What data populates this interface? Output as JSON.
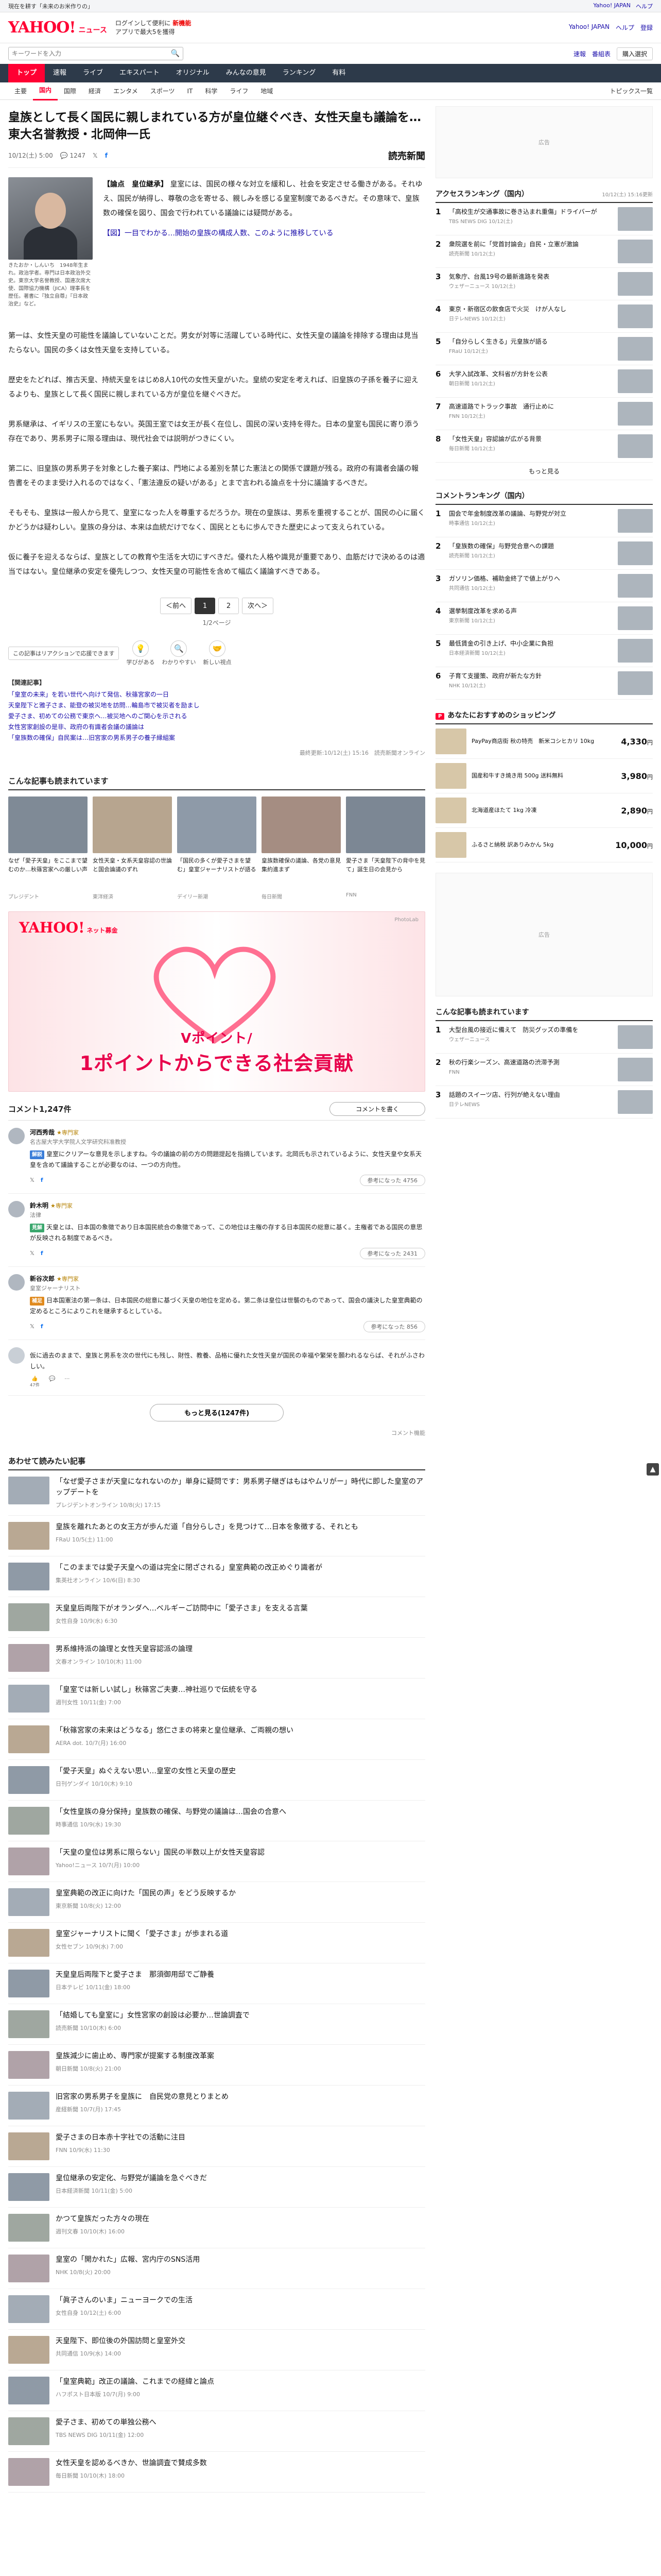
{
  "top_strip": {
    "left_text": "現在を耕す「未来のお米作りの」",
    "links": [
      "Yahoo! JAPAN",
      "ヘルプ"
    ]
  },
  "header": {
    "logo": "YAHOO!",
    "logo_sub": "ニュース",
    "logo_region": "JAPAN",
    "promo_line1": "ログインして便利に",
    "promo_line1_bold": "新機能",
    "promo_line2": "アプリで最大5を獲得",
    "links": [
      "Yahoo! JAPAN",
      "ヘルプ",
      "登録"
    ]
  },
  "search": {
    "placeholder": "キーワードを入力",
    "right_links": [
      "速報",
      "番組表"
    ],
    "right_button": "購入選択"
  },
  "nav": {
    "categories": [
      "トップ",
      "速報",
      "ライブ",
      "エキスパート",
      "オリジナル",
      "みんなの意見",
      "ランキング",
      "有料"
    ],
    "active_category": "トップ"
  },
  "subnav": {
    "items": [
      "主要",
      "国内",
      "国際",
      "経済",
      "エンタメ",
      "スポーツ",
      "IT",
      "科学",
      "ライフ",
      "地域"
    ],
    "active": "国内",
    "right": "トピックス一覧"
  },
  "article": {
    "title": "皇族として長く国民に親しまれている方が皇位継ぐべき、女性天皇も議論を…東大名誉教授・北岡伸一氏",
    "date": "10/12(土) 5:00",
    "comments_count": "1247",
    "source": "読売新聞",
    "section_tag": "【論点　皇位継承】",
    "photo_caption": "きたおか・しんいち　1948年生まれ。政治学者。専門は日本政治外交史。東京大学名誉教授、国連次席大使、国際協力機構（JICA）理事長を歴任。著書に『独立自尊』『日本政治史』など。",
    "lead_para": "皇室には、国民の様々な対立を緩和し、社会を安定させる働きがある。それゆえ、国民が納得し、尊敬の念を寄せる、親しみを感じる皇室制度であるべきだ。その意味で、皇族数の確保を図り、国会で行われている議論には疑問がある。",
    "lead_link": "【図】一目でわかる…開始の皇族の構成人数、このように推移している",
    "paragraphs": [
      "第一は、女性天皇の可能性を議論していないことだ。男女が対等に活躍している時代に、女性天皇の議論を排除する理由は見当たらない。国民の多くは女性天皇を支持している。",
      "歴史をたどれば、推古天皇、持統天皇をはじめ8人10代の女性天皇がいた。皇統の安定を考えれば、旧皇族の子孫を養子に迎えるよりも、皇族として長く国民に親しまれている方が皇位を継ぐべきだ。",
      "男系継承は、イギリスの王室にもない。英国王室では女王が長く在位し、国民の深い支持を得た。日本の皇室も国民に寄り添う存在であり、男系男子に限る理由は、現代社会では説明がつきにくい。",
      "第二に、旧皇族の男系男子を対象とした養子案は、門地による差別を禁じた憲法との関係で課題が残る。政府の有識者会議の報告書をそのまま受け入れるのではなく、「憲法違反の疑いがある」とまで言われる論点を十分に議論するべきだ。",
      "そもそも、皇族は一般人から見て、皇室になった人を尊重するだろうか。現在の皇族は、男系を重視することが、国民の心に届くかどうかは疑わしい。皇族の身分は、本来は血統だけでなく、国民とともに歩んできた歴史によって支えられている。",
      "仮に養子を迎えるならば、皇族としての教育や生活を大切にすべきだ。優れた人格や識見が重要であり、血筋だけで決めるのは適当ではない。皇位継承の安定を優先しつつ、女性天皇の可能性を含めて幅広く議論すべきである。"
    ],
    "pager": {
      "prev": "＜前へ",
      "pages": [
        "1",
        "2"
      ],
      "current": "1",
      "next": "次へ＞",
      "count": "1/2ページ"
    },
    "reaction_label": "この記事はリアクションで応援できます",
    "reactions": [
      {
        "icon": "💡",
        "label": "学びがある"
      },
      {
        "icon": "🔍",
        "label": "わかりやすい"
      },
      {
        "icon": "🤝",
        "label": "新しい視点"
      }
    ],
    "related_title": "【関連記事】",
    "related_links": [
      "「皇室の未来」を若い世代へ向けて発信、秋篠宮家の一日",
      "天皇陛下と雅子さま、能登の被災地を訪問…輪島市で被災者を励まし",
      "愛子さま、初めての公務で東京へ…被災地へのご関心を示される",
      "女性宮家創設の是非、政府の有識者会議の議論は",
      "「皇族数の確保」自民案は…旧宮家の男系男子の養子縁組案"
    ],
    "copyright": "最終更新:10/12(土) 15:16　読売新聞オンライン"
  },
  "picks": {
    "title": "こんな記事も読まれています",
    "items": [
      {
        "title": "なぜ「愛子天皇」をここまで望むのか…秋篠宮家への厳しい声",
        "meta": "プレジデント"
      },
      {
        "title": "女性天皇・女系天皇容認の世論と国会論議のずれ",
        "meta": "東洋経済"
      },
      {
        "title": "「国民の多くが愛子さまを望む」皇室ジャーナリストが語る",
        "meta": "デイリー新潮"
      },
      {
        "title": "皇族数確保の議論、各党の意見集約進まず",
        "meta": "毎日新聞"
      },
      {
        "title": "愛子さま「天皇陛下の背中を見て」誕生日の会見から",
        "meta": "FNN"
      }
    ]
  },
  "ad": {
    "logo": "YAHOO!",
    "logo_sub": "ネット募金",
    "corner": "PhotoLab",
    "copy_small": "Vポイント/",
    "copy_main": "1ポイントからできる社会貢献"
  },
  "comments": {
    "title": "コメント1,247件",
    "write_button": "コメントを書く",
    "items": [
      {
        "name": "河西秀哉",
        "badge": "★専門家",
        "role": "名古屋大学大学院人文学研究科准教授",
        "tag": "解説",
        "tag_color": "#3b7dd8",
        "text": "皇室にクリアーな意見を示しますね。今の議論の前の方の問題提起を指摘しています。北岡氏も示されているように、女性天皇や女系天皇を含めて議論することが必要なのは、一つの方向性。",
        "agree": "参考になった 4756"
      },
      {
        "name": "鈴木明",
        "badge": "★専門家",
        "role": "法律",
        "tag": "見解",
        "tag_color": "#3aa76d",
        "text": "天皇とは、日本国の象徴であり日本国民統合の象徴であって、この地位は主権の存する日本国民の総意に基く。主権者である国民の意思が反映される制度であるべき。",
        "agree": "参考になった 2431"
      },
      {
        "name": "新谷次郎",
        "badge": "★専門家",
        "role": "皇室ジャーナリスト",
        "tag": "補足",
        "tag_color": "#e08a1e",
        "text": "日本国憲法の第一条は、日本国民の総意に基づく天皇の地位を定める。第二条は皇位は世襲のものであって、国会の議決した皇室典範の定めるところによりこれを継承するとしている。",
        "agree": "参考になった 856"
      }
    ],
    "reader_comment": "仮に過去のままで、皇族と男系を次の世代にも残し、財性、教養、品格に優れた女性天皇が国民の幸福や繁栄を願われるならば、それがふさわしい。",
    "reader_likes": "47件",
    "more_button": "もっと見る(1247件)",
    "note": "コメント機能"
  },
  "also_read": {
    "title": "あわせて読みたい記事",
    "items": [
      {
        "title": "「なぜ愛子さまが天皇になれないのか」単身に疑問です：男系男子継ぎはもはやムリがー」時代に即した皇室のアップデートを",
        "meta": "プレジデントオンライン 10/8(火) 17:15"
      },
      {
        "title": "皇族を離れたあとの女王方が歩んだ道「自分らしさ」を見つけて…日本を象徴する、それとも",
        "meta": "FRaU 10/5(土) 11:00"
      },
      {
        "title": "「このままでは愛子天皇への道は完全に閉ざされる」皇室典範の改正めぐり識者が",
        "meta": "集英社オンライン 10/6(日) 8:30"
      },
      {
        "title": "天皇皇后両陛下がオランダへ…ベルギーご訪問中に「愛子さま」を支える言葉",
        "meta": "女性自身 10/9(水) 6:30"
      },
      {
        "title": "男系維持派の論理と女性天皇容認派の論理",
        "meta": "文春オンライン 10/10(木) 11:00"
      },
      {
        "title": "「皇室では新しい試し」秋篠宮ご夫妻…神社巡りで伝統を守る",
        "meta": "週刊女性 10/11(金) 7:00"
      },
      {
        "title": "「秋篠宮家の未来はどうなる」悠仁さまの将来と皇位継承、ご両親の想い",
        "meta": "AERA dot. 10/7(月) 16:00"
      },
      {
        "title": "「愛子天皇」ぬぐえない思い…皇室の女性と天皇の歴史",
        "meta": "日刊ゲンダイ 10/10(木) 9:10"
      },
      {
        "title": "「女性皇族の身分保持」皇族数の確保、与野党の議論は…国会の合意へ",
        "meta": "時事通信 10/9(水) 19:30"
      },
      {
        "title": "「天皇の皇位は男系に限らない」国民の半数以上が女性天皇容認",
        "meta": "Yahoo!ニュース 10/7(月) 10:00"
      },
      {
        "title": "皇室典範の改正に向けた「国民の声」をどう反映するか",
        "meta": "東京新聞 10/8(火) 12:00"
      },
      {
        "title": "皇室ジャーナリストに聞く「愛子さま」が歩まれる道",
        "meta": "女性セブン 10/9(水) 7:00"
      },
      {
        "title": "天皇皇后両陛下と愛子さま　那須御用邸でご静養",
        "meta": "日本テレビ 10/11(金) 18:00"
      },
      {
        "title": "「結婚しても皇室に」女性宮家の創設は必要か…世論調査で",
        "meta": "読売新聞 10/10(木) 6:00"
      },
      {
        "title": "皇族減少に歯止め、専門家が提案する制度改革案",
        "meta": "朝日新聞 10/8(火) 21:00"
      },
      {
        "title": "旧宮家の男系男子を皇族に　自民党の意見とりまとめ",
        "meta": "産経新聞 10/7(月) 17:45"
      },
      {
        "title": "愛子さまの日本赤十字社での活動に注目",
        "meta": "FNN 10/9(水) 11:30"
      },
      {
        "title": "皇位継承の安定化、与野党が議論を急ぐべきだ",
        "meta": "日本経済新聞 10/11(金) 5:00"
      },
      {
        "title": "かつて皇族だった方々の現在",
        "meta": "週刊文春 10/10(木) 16:00"
      },
      {
        "title": "皇室の「開かれた」広報、宮内庁のSNS活用",
        "meta": "NHK 10/8(火) 20:00"
      },
      {
        "title": "「眞子さんのいま」ニューヨークでの生活",
        "meta": "女性自身 10/12(土) 6:00"
      },
      {
        "title": "天皇陛下、即位後の外国訪問と皇室外交",
        "meta": "共同通信 10/9(水) 14:00"
      },
      {
        "title": "「皇室典範」改正の議論、これまでの経緯と論点",
        "meta": "ハフポスト日本版 10/7(月) 9:00"
      },
      {
        "title": "愛子さま、初めての単独公務へ",
        "meta": "TBS NEWS DIG 10/11(金) 12:00"
      },
      {
        "title": "女性天皇を認めるべきか、世論調査で賛成多数",
        "meta": "毎日新聞 10/10(木) 18:00"
      }
    ]
  },
  "sidebar": {
    "ad_label": "広告",
    "access_ranking_title": "アクセスランキング（国内）",
    "access_ranking_note": "10/12(土) 15:16更新",
    "ranking": [
      {
        "title": "「高校生が交通事故に巻き込まれ重傷」ドライバーが",
        "meta": "TBS NEWS DIG 10/12(土)"
      },
      {
        "title": "衆院選を前に「党首討論会」自民・立憲が激論",
        "meta": "読売新聞 10/12(土)"
      },
      {
        "title": "気象庁、台風19号の最新進路を発表",
        "meta": "ウェザーニュース 10/12(土)"
      },
      {
        "title": "東京・新宿区の飲食店で火災　けが人なし",
        "meta": "日テレNEWS 10/12(土)"
      },
      {
        "title": "「自分らしく生きる」元皇族が語る",
        "meta": "FRaU 10/12(土)"
      },
      {
        "title": "大学入試改革、文科省が方針を公表",
        "meta": "朝日新聞 10/12(土)"
      },
      {
        "title": "高速道路でトラック事故　通行止めに",
        "meta": "FNN 10/12(土)"
      },
      {
        "title": "「女性天皇」容認論が広がる背景",
        "meta": "毎日新聞 10/12(土)"
      }
    ],
    "ranking_more": "もっと見る",
    "comment_ranking_title": "コメントランキング（国内）",
    "comment_ranking": [
      {
        "title": "国会で年金制度改革の議論、与野党が対立",
        "meta": "時事通信 10/12(土)"
      },
      {
        "title": "「皇族数の確保」与野党合意への課題",
        "meta": "読売新聞 10/12(土)"
      },
      {
        "title": "ガソリン価格、補助金終了で値上がりへ",
        "meta": "共同通信 10/12(土)"
      },
      {
        "title": "選挙制度改革を求める声",
        "meta": "東京新聞 10/12(土)"
      },
      {
        "title": "最低賃金の引き上げ、中小企業に負担",
        "meta": "日本経済新聞 10/12(土)"
      },
      {
        "title": "子育て支援策、政府が新たな方針",
        "meta": "NHK 10/12(土)"
      }
    ],
    "shop_title": "あなたにおすすめのショッピング",
    "shop_items": [
      {
        "title": "PayPay商店街 秋の特売　新米コシヒカリ 10kg",
        "price": "4,330",
        "unit": "円"
      },
      {
        "title": "国産和牛すき焼き用 500g 送料無料",
        "price": "3,980",
        "unit": "円"
      },
      {
        "title": "北海道産ほたて 1kg 冷凍",
        "price": "2,890",
        "unit": "円"
      },
      {
        "title": "ふるさと納税 訳ありみかん 5kg",
        "price": "10,000",
        "unit": "円"
      }
    ],
    "ad2_label": "広告",
    "video_ranking_title": "こんな記事も読まれています",
    "video_ranking": [
      {
        "title": "大型台風の接近に備えて　防災グッズの準備を",
        "meta": "ウェザーニュース"
      },
      {
        "title": "秋の行楽シーズン、高速道路の渋滞予測",
        "meta": "FNN"
      },
      {
        "title": "話題のスイーツ店、行列が絶えない理由",
        "meta": "日テレNEWS"
      }
    ]
  }
}
